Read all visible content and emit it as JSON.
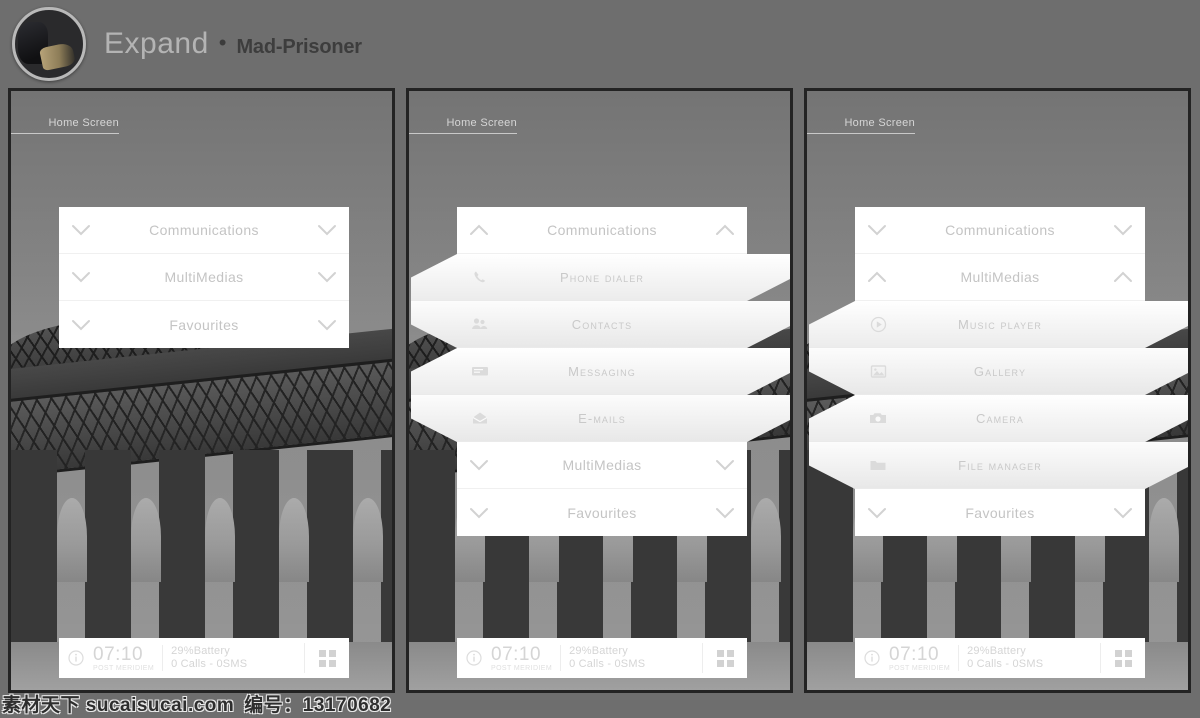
{
  "header": {
    "brand_main": "Expand",
    "brand_separator": "•",
    "brand_sub": "Mad-Prisoner",
    "avatar_name": "avatar"
  },
  "screen_label": "Home Screen",
  "status_bar": {
    "info_icon": "info-circle-icon",
    "time": "07:10",
    "time_meridiem": "post meridiem",
    "line1": "29%Battery",
    "line2": "0 Calls - 0SMS",
    "grid_icon": "app-grid-icon"
  },
  "menu": {
    "groups": [
      {
        "label": "Communications"
      },
      {
        "label": "MultiMedias"
      },
      {
        "label": "Favourites"
      }
    ],
    "communications_items": [
      {
        "label": "Phone Dialer",
        "icon": "phone-icon"
      },
      {
        "label": "Contacts",
        "icon": "contacts-icon"
      },
      {
        "label": "Messaging",
        "icon": "message-icon"
      },
      {
        "label": "E-Mails",
        "icon": "envelope-icon"
      }
    ],
    "multimedias_items": [
      {
        "label": "Music Player",
        "icon": "play-circle-icon"
      },
      {
        "label": "Gallery",
        "icon": "image-icon"
      },
      {
        "label": "Camera",
        "icon": "camera-icon"
      },
      {
        "label": "File Manager",
        "icon": "folder-icon"
      }
    ]
  },
  "panels": [
    {
      "name": "panel-collapsed",
      "expanded": "none"
    },
    {
      "name": "panel-communications-expanded",
      "expanded": "Communications"
    },
    {
      "name": "panel-multimedias-expanded",
      "expanded": "MultiMedias"
    }
  ],
  "watermark": {
    "site": "素材天下 sucaisucai.com",
    "code": "编号：13170682"
  },
  "colors": {
    "page_background": "#6e6e6e",
    "panel_border": "#232323",
    "menu_background": "#ffffff",
    "menu_text": "#c4c4c4",
    "brand_main": "#b4b4b4",
    "brand_sub": "#3d3d3d"
  }
}
